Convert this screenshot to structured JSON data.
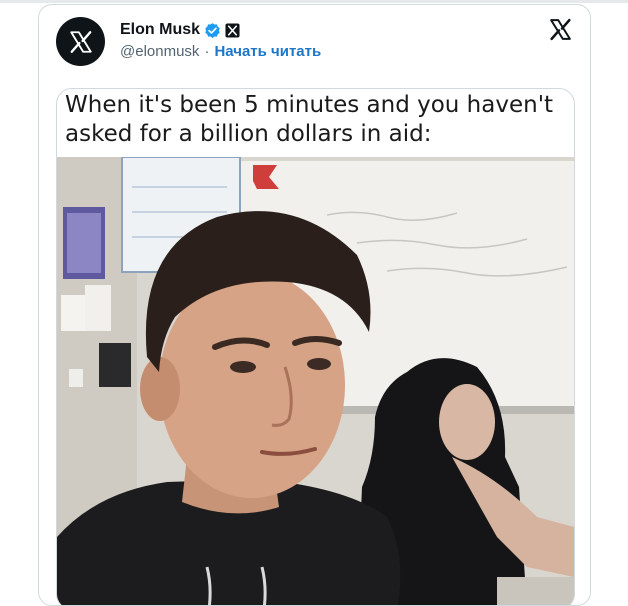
{
  "tweet": {
    "author_name": "Elon Musk",
    "handle": "@elonmusk",
    "separator": "·",
    "follow_label": "Начать читать",
    "meme_caption": "When it's been 5 minutes and you haven't asked for a billion dollars in aid:"
  },
  "colors": {
    "verified": "#1d9bf0",
    "link": "#1d77c9",
    "text": "#0f1419",
    "muted": "#536471"
  },
  "icons": [
    "x-logo-icon",
    "verified-badge-icon",
    "affiliate-x-icon",
    "x-logo-icon"
  ]
}
